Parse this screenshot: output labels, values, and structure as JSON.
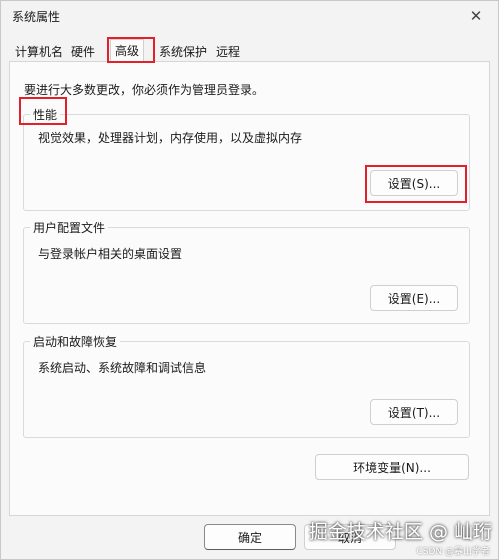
{
  "window": {
    "title": "系统属性",
    "close_label": "✕"
  },
  "tabs": [
    {
      "label": "计算机名"
    },
    {
      "label": "硬件"
    },
    {
      "label": "高级"
    },
    {
      "label": "系统保护"
    },
    {
      "label": "远程"
    }
  ],
  "active_tab": "高级",
  "admin_note": "要进行大多数更改，你必须作为管理员登录。",
  "performance": {
    "label": "性能",
    "description": "视觉效果，处理器计划，内存使用，以及虚拟内存",
    "button": "设置(S)..."
  },
  "user_profiles": {
    "label": "用户配置文件",
    "description": "与登录帐户相关的桌面设置",
    "button": "设置(E)..."
  },
  "startup_recovery": {
    "label": "启动和故障恢复",
    "description": "系统启动、系统故障和调试信息",
    "button": "设置(T)..."
  },
  "env_button": "环境变量(N)...",
  "footer": {
    "ok": "确定",
    "cancel": "取消"
  },
  "watermark": {
    "main": "掘金技术社区 @ 屾珩",
    "small": "CSDN @暴山学者"
  },
  "colors": {
    "highlight": "#e0202a",
    "background": "#f3f3f3",
    "panel": "#fbfbfb"
  }
}
